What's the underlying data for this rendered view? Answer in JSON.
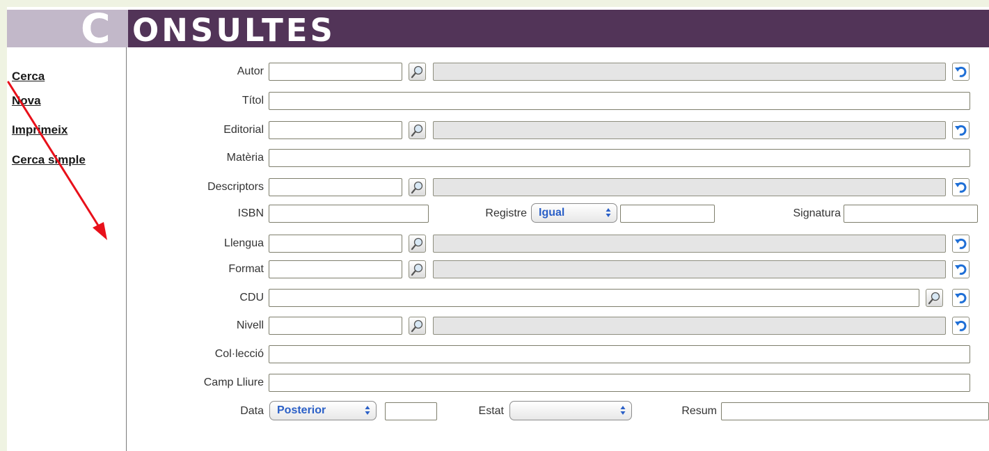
{
  "header": {
    "title_first": "C",
    "title_rest": "ONSULTES"
  },
  "sidebar": {
    "links": [
      "Cerca",
      "Nova",
      "Imprimeix",
      "Cerca simple"
    ]
  },
  "form": {
    "labels": {
      "autor": "Autor",
      "titol": "Títol",
      "editorial": "Editorial",
      "materia": "Matèria",
      "descriptors": "Descriptors",
      "isbn": "ISBN",
      "registre": "Registre",
      "signatura": "Signatura",
      "llengua": "Llengua",
      "format": "Format",
      "cdu": "CDU",
      "nivell": "Nivell",
      "colleccio": "Col·lecció",
      "camp_lliure": "Camp Lliure",
      "data": "Data",
      "estat": "Estat",
      "resum": "Resum"
    },
    "selects": {
      "registre": "Igual",
      "data": "Posterior",
      "estat": ""
    }
  },
  "colors": {
    "header_dark": "#523458",
    "header_light": "#c2b8c9",
    "annotation_arrow": "#e8101a",
    "select_text": "#2a5fc7"
  },
  "icons": [
    "search-icon",
    "reset-icon",
    "chevron-updown-icon"
  ]
}
